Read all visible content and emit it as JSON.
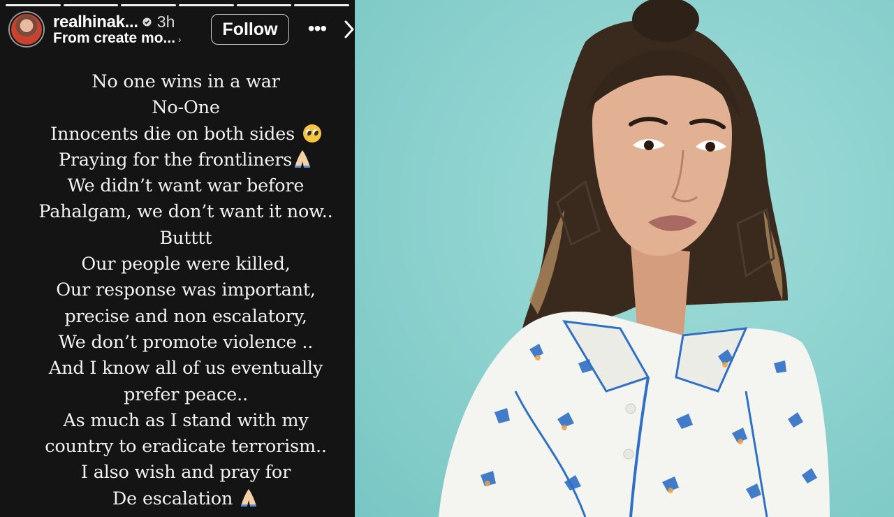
{
  "story": {
    "username": "realhinak...",
    "time_ago": "3h",
    "subtitle": "From create mo...",
    "follow_label": "Follow",
    "more_icon": "more-horizontal-icon",
    "next_icon": "chevron-right-icon",
    "progress_segments": 6,
    "lines": [
      "No one wins in a war",
      "No-One",
      "Innocents die on both sides",
      "Praying for the frontliners",
      "We didn’t want war before",
      "Pahalgam, we don’t want it now..",
      "Butttt",
      "Our people were killed,",
      "Our response was important,",
      "precise and non escalatory,",
      "We don’t promote violence ..",
      "And I know all of us eventually",
      "prefer peace..",
      "As much as I stand with my",
      "country to eradicate terrorism..",
      "I also wish and pray for",
      "De escalation"
    ]
  },
  "photo": {
    "background_color": "#8fd3d0",
    "subject": "woman-portrait-image"
  },
  "colors": {
    "story_bg": "#141414",
    "text": "#f2f2f2",
    "accent_blue": "#2f6fc4"
  }
}
